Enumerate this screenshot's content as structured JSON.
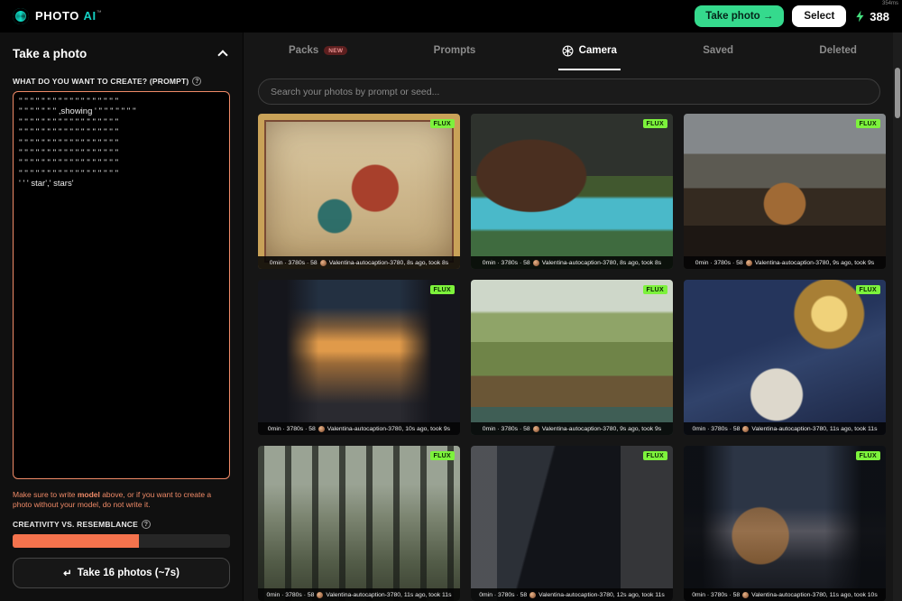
{
  "meta": {
    "latency": "354ms"
  },
  "header": {
    "logo_photo": "PHOTO",
    "logo_ai": "AI",
    "logo_tm": "™",
    "take_photo_button": "Take photo →",
    "select_button": "Select",
    "credits": "388"
  },
  "tabs": [
    {
      "label": "Packs",
      "badge": "NEW"
    },
    {
      "label": "Prompts"
    },
    {
      "label": "Camera"
    },
    {
      "label": "Saved"
    },
    {
      "label": "Deleted"
    }
  ],
  "search": {
    "placeholder": "Search your photos by prompt or seed..."
  },
  "icons": {
    "help": "?",
    "return": "↵"
  },
  "sidebar": {
    "panel_title": "Take a photo",
    "prompt_label": "WHAT DO YOU WANT TO CREATE? (PROMPT)",
    "prompt_value": "'' '' '' '' '' '' '' '' '' '' '' '' '' '' '' '' '' ''\n'' '' '' '' '' '' '' ,showing ' '' '' '' '' '' '' ''\n'' '' '' '' '' '' '' '' '' '' '' '' '' '' '' '' '' ''\n'' '' '' '' '' '' '' '' '' '' '' '' '' '' '' '' '' ''\n'' '' '' '' '' '' '' '' '' '' '' '' '' '' '' '' '' ''\n'' '' '' '' '' '' '' '' '' '' '' '' '' '' '' '' '' ''\n'' '' '' '' '' '' '' '' '' '' '' '' '' '' '' '' '' ''\n'' '' '' '' '' '' '' '' '' '' '' '' '' '' '' '' '' ''\n' ' ' star',' stars'",
    "model_note_pre": "Make sure to write ",
    "model_note_bold": "model",
    "model_note_post": " above, or if you want to create a photo without your model, do not write it.",
    "creativity_label": "CREATIVITY VS. RESEMBLANCE",
    "take_button_label": "Take 16 photos (~7s)"
  },
  "photos": [
    {
      "badge": "FLUX",
      "meta": "0min · 3780s · 58",
      "info": "Valentina-autocaption-3780, 8s ago, took 8s"
    },
    {
      "badge": "FLUX",
      "meta": "0min · 3780s · 58",
      "info": "Valentina-autocaption-3780, 8s ago, took 8s"
    },
    {
      "badge": "FLUX",
      "meta": "0min · 3780s · 58",
      "info": "Valentina-autocaption-3780, 9s ago, took 9s"
    },
    {
      "badge": "FLUX",
      "meta": "0min · 3780s · 58",
      "info": "Valentina-autocaption-3780, 10s ago, took 9s"
    },
    {
      "badge": "FLUX",
      "meta": "0min · 3780s · 58",
      "info": "Valentina-autocaption-3780, 9s ago, took 9s"
    },
    {
      "badge": "FLUX",
      "meta": "0min · 3780s · 58",
      "info": "Valentina-autocaption-3780, 11s ago, took 11s"
    },
    {
      "badge": "FLUX",
      "meta": "0min · 3780s · 58",
      "info": "Valentina-autocaption-3780, 11s ago, took 11s"
    },
    {
      "badge": "FLUX",
      "meta": "0min · 3780s · 58",
      "info": "Valentina-autocaption-3780, 12s ago, took 11s"
    },
    {
      "badge": "FLUX",
      "meta": "0min · 3780s · 58",
      "info": "Valentina-autocaption-3780, 11s ago, took 10s"
    }
  ]
}
